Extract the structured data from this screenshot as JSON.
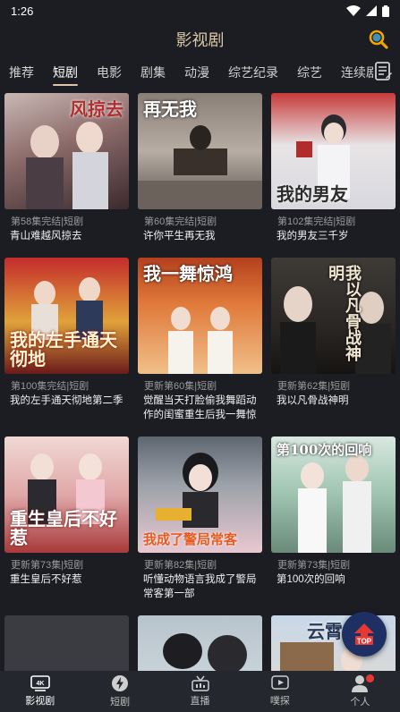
{
  "status": {
    "time": "1:26"
  },
  "header": {
    "title": "影视剧"
  },
  "tabs": [
    "推荐",
    "短剧",
    "电影",
    "剧集",
    "动漫",
    "综艺纪录",
    "综艺",
    "连续剧"
  ],
  "active_tab": "短剧",
  "cards": [
    {
      "meta": "第58集完结|短剧",
      "title": "青山难越风掠去",
      "overlay": "风掠去"
    },
    {
      "meta": "第60集完结|短剧",
      "title": "许你平生再无我",
      "overlay": "再无我"
    },
    {
      "meta": "第102集完结|短剧",
      "title": "我的男友三千岁",
      "overlay": "我的男友"
    },
    {
      "meta": "第100集完结|短剧",
      "title": "我的左手通天彻地第二季",
      "overlay": "我的左手通天彻地"
    },
    {
      "meta": "更新第60集|短剧",
      "title": "觉醒当天打脸偷我舞蹈动作的闺蜜重生后我一舞惊",
      "overlay": "我一舞惊鸿"
    },
    {
      "meta": "更新第62集|短剧",
      "title": "我以凡骨战神明",
      "overlay": "我以凡骨战神明"
    },
    {
      "meta": "更新第73集|短剧",
      "title": "重生皇后不好惹",
      "overlay": "重生皇后不好惹"
    },
    {
      "meta": "更新第82集|短剧",
      "title": "听懂动物语言我成了警局常客第一部",
      "overlay": "我成了警局常客"
    },
    {
      "meta": "更新第73集|短剧",
      "title": "第100次的回响",
      "overlay": "第100次的回响"
    },
    {
      "meta": "",
      "title": "",
      "overlay": ""
    },
    {
      "meta": "",
      "title": "",
      "overlay": ""
    },
    {
      "meta": "",
      "title": "",
      "overlay": "云霄"
    }
  ],
  "fab": {
    "label": "TOP"
  },
  "bottom_nav": [
    {
      "label": "影视剧",
      "icon": "film-4k-icon"
    },
    {
      "label": "短剧",
      "icon": "lightning-icon"
    },
    {
      "label": "直播",
      "icon": "live-icon"
    },
    {
      "label": "噗探",
      "icon": "play-square-icon"
    },
    {
      "label": "个人",
      "icon": "person-icon"
    }
  ],
  "colors": {
    "accent": "#d9c7a6",
    "background": "#1b1d22",
    "nav": "#24272d",
    "fab": "#1d2f63",
    "badge": "#e53935"
  }
}
